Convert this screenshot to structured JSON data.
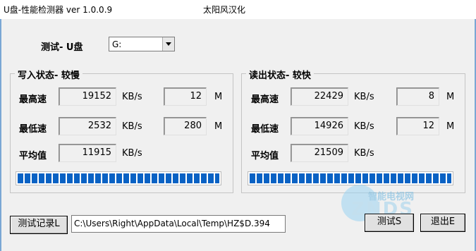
{
  "window": {
    "title": "U盘-性能检测器  ver 1.0.0.9",
    "credit": "太阳风汉化"
  },
  "drive": {
    "label": "测试- U盘",
    "selected": "G:"
  },
  "write": {
    "group_title": "写入状态- 较慢",
    "max_label": "最高速",
    "max_value": "19152",
    "max_unit": "KB/s",
    "max_size": "12",
    "max_size_unit": "M",
    "min_label": "最低速",
    "min_value": "2532",
    "min_unit": "KB/s",
    "min_size": "280",
    "min_size_unit": "M",
    "avg_label": "平均值",
    "avg_value": "11915",
    "avg_unit": "KB/s",
    "progress": 1.0
  },
  "read": {
    "group_title": "读出状态- 较快",
    "max_label": "最高速",
    "max_value": "22429",
    "max_unit": "KB/s",
    "max_size": "8",
    "max_size_unit": "M",
    "min_label": "最低速",
    "min_value": "14926",
    "min_unit": "KB/s",
    "min_size": "12",
    "min_size_unit": "M",
    "avg_label": "平均值",
    "avg_value": "21509",
    "avg_unit": "KB/s",
    "progress": 1.0
  },
  "footer": {
    "log_button": "测试记录L",
    "path": "C:\\Users\\Right\\AppData\\Local\\Temp\\HZ$D.394",
    "test_button": "测试S",
    "exit_button": "退出E"
  },
  "watermark": {
    "line1": "智能电视网",
    "line2": "ZNDS"
  },
  "colors": {
    "progress": "#0a62c4",
    "background": "#f0f0f0"
  }
}
